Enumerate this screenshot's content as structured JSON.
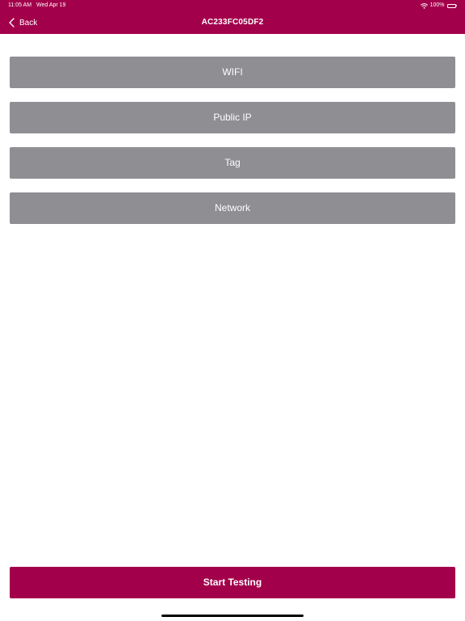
{
  "status_bar": {
    "time": "11:05 AM",
    "date": "Wed Apr 19",
    "battery": "100%",
    "wifi_icon": "wifi-icon",
    "battery_icon": "battery-icon"
  },
  "nav": {
    "back_label": "Back",
    "back_icon": "chevron-left-icon",
    "title": "AC233FC05DF2"
  },
  "options": [
    {
      "label": "WIFI"
    },
    {
      "label": "Public IP"
    },
    {
      "label": "Tag"
    },
    {
      "label": "Network"
    }
  ],
  "start_button": {
    "label": "Start Testing"
  },
  "colors": {
    "brand": "#a3004b",
    "option_bg": "#8e8e93",
    "text_on_dark": "#ffffff",
    "background": "#ffffff"
  }
}
